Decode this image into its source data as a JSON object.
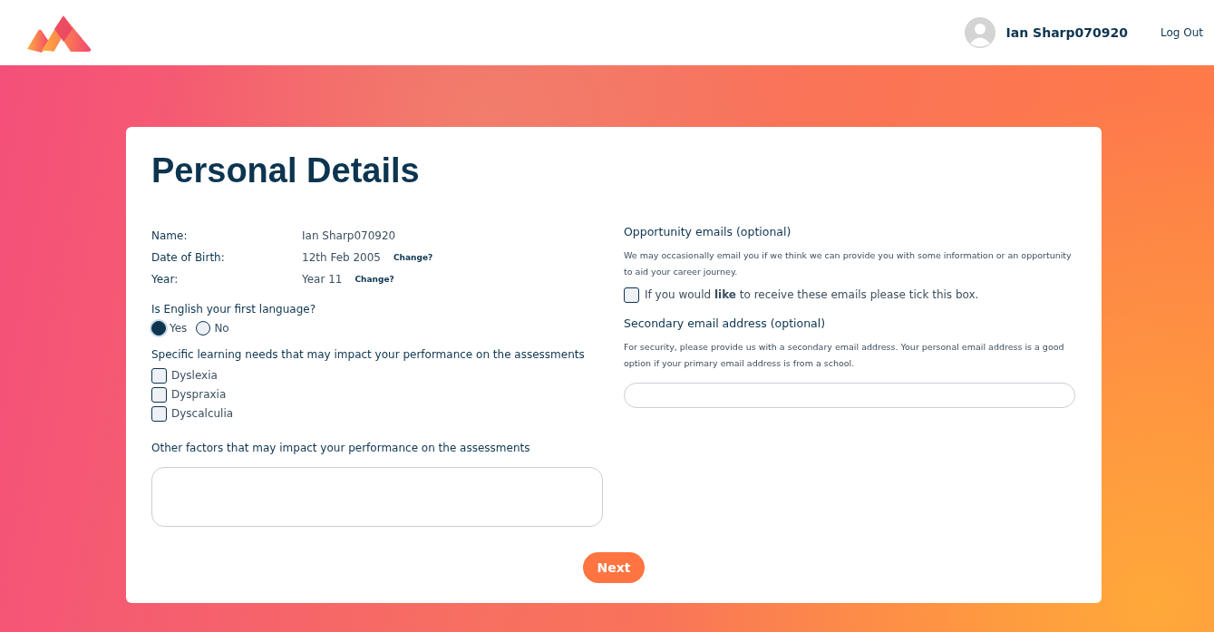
{
  "header": {
    "user_name": "Ian Sharp070920",
    "logout": "Log Out"
  },
  "title": "Personal Details",
  "details": [
    {
      "label": "Name:",
      "value": "Ian Sharp070920"
    },
    {
      "label": "Date of Birth:",
      "value": "12th Feb 2005",
      "link": "Change?"
    },
    {
      "label": "Year:",
      "value": "Year 11",
      "link": "Change?"
    }
  ],
  "english_question": {
    "label": "Is English your first language?",
    "options": [
      {
        "label": "Yes",
        "selected": true
      },
      {
        "label": "No",
        "selected": false
      }
    ]
  },
  "learning_needs": {
    "label": "Specific learning needs that may impact your performance on the assessments",
    "options": [
      {
        "label": "Dyslexia",
        "checked": false
      },
      {
        "label": "Dyspraxia",
        "checked": false
      },
      {
        "label": "Dyscalculia",
        "checked": false
      }
    ]
  },
  "other_factors": {
    "label": "Other factors that may impact your performance on the assessments"
  },
  "opportunity_emails": {
    "heading": "Opportunity emails (optional)",
    "description": "We may occasionally email you if we think we can provide you with some information or an opportunity to aid your career journey.",
    "checkbox_label": "If you would **like** to receive these emails please tick this box.",
    "checked": false
  },
  "secondary_email": {
    "heading": "Secondary email address (optional)",
    "description": "For security, please provide us with a secondary email address. Your personal email address is a good option if your primary email address is from a school."
  },
  "next_button": "Next"
}
